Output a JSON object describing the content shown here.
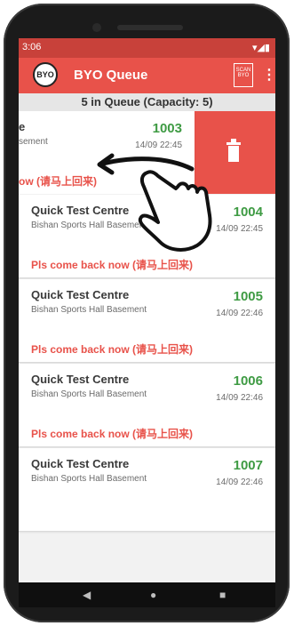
{
  "status_bar": {
    "time": "3:06",
    "icons": "▾◢▮"
  },
  "app_bar": {
    "logo_text": "BYO",
    "title": "BYO Queue",
    "scan_label_lines": [
      "SCAN",
      "BYO"
    ],
    "menu": "⋮"
  },
  "queue_header": "5 in Queue (Capacity: 5)",
  "swiped_item": {
    "center_partial": "e",
    "location_partial": "sement",
    "number": "1003",
    "timestamp": "14/09 22:45",
    "message_partial": "ow (请马上回来)"
  },
  "queue_items": [
    {
      "center": "Quick Test Centre",
      "location": "Bishan Sports Hall Basement",
      "number": "1004",
      "timestamp": "14/09 22:45",
      "message": "Pls come back now (请马上回来)"
    },
    {
      "center": "Quick Test Centre",
      "location": "Bishan Sports Hall Basement",
      "number": "1005",
      "timestamp": "14/09 22:46",
      "message": "Pls come back now (请马上回来)"
    },
    {
      "center": "Quick Test Centre",
      "location": "Bishan Sports Hall Basement",
      "number": "1006",
      "timestamp": "14/09 22:46",
      "message": "Pls come back now (请马上回来)"
    },
    {
      "center": "Quick Test Centre",
      "location": "Bishan Sports Hall Basement",
      "number": "1007",
      "timestamp": "14/09 22:46",
      "message": ""
    }
  ],
  "nav": {
    "back": "◀",
    "home": "●",
    "recents": "■"
  }
}
